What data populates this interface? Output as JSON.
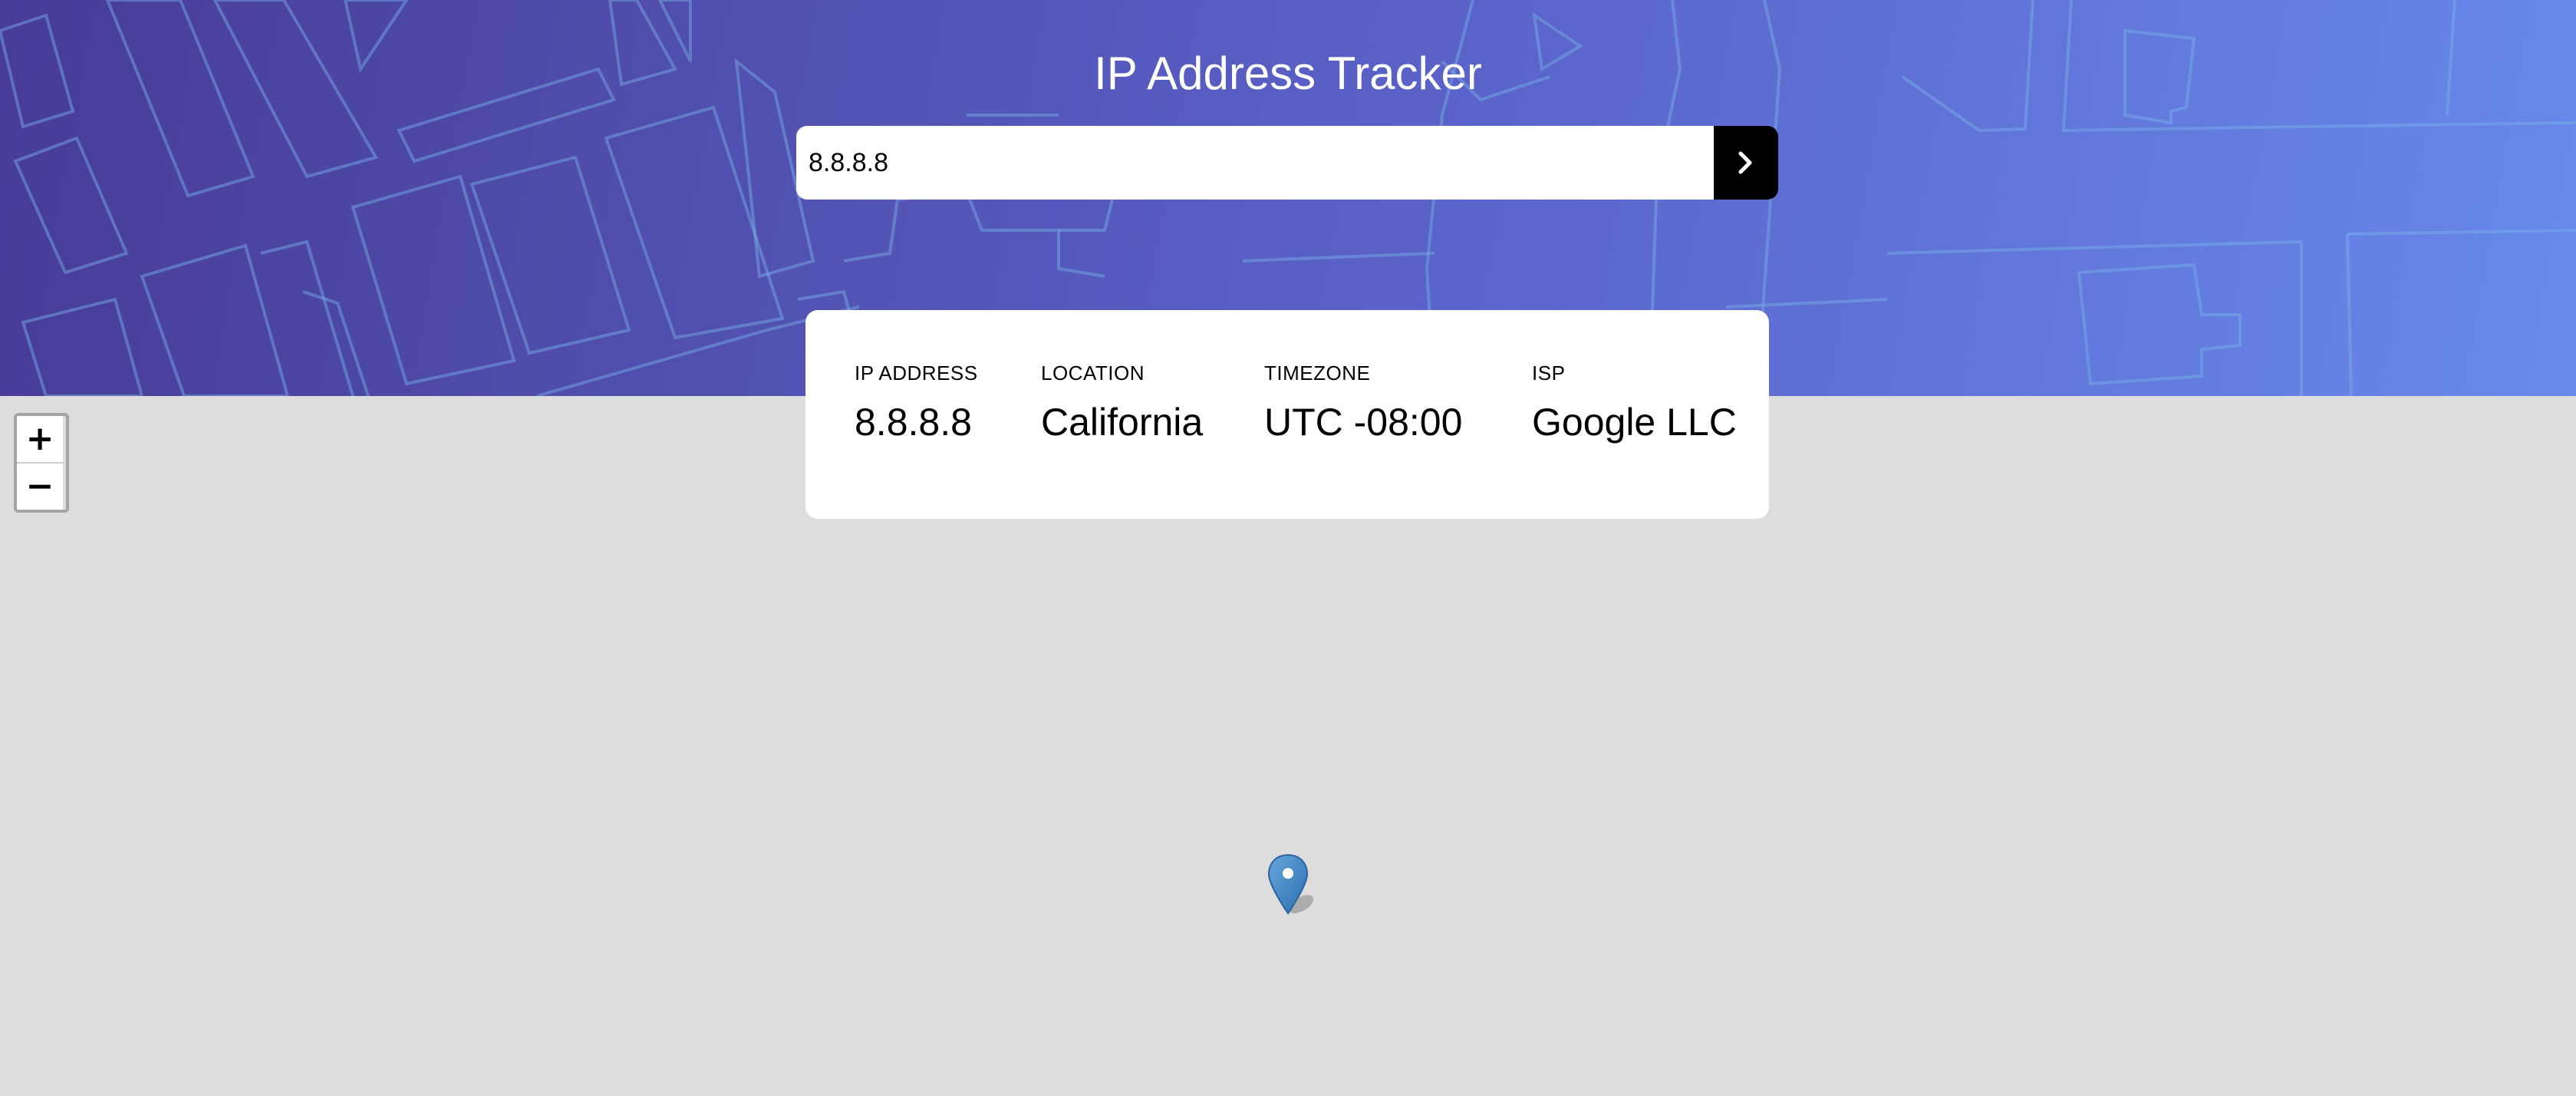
{
  "header": {
    "title": "IP Address Tracker"
  },
  "search": {
    "value": "8.8.8.8",
    "submit_icon": "chevron-right-icon"
  },
  "info": {
    "ip_address": {
      "label": "IP ADDRESS",
      "value": "8.8.8.8"
    },
    "location": {
      "label": "LOCATION",
      "value": "California"
    },
    "timezone": {
      "label": "TIMEZONE",
      "value": "UTC -08:00"
    },
    "isp": {
      "label": "ISP",
      "value": "Google LLC"
    }
  },
  "map": {
    "zoom_in_label": "+",
    "zoom_out_label": "−",
    "marker_icon": "map-pin-icon"
  },
  "colors": {
    "header_gradient_start": "#473c96",
    "header_gradient_end": "#6889ec",
    "map_background": "#dddddd",
    "button_background": "#000000",
    "marker": "#3f86c8"
  }
}
